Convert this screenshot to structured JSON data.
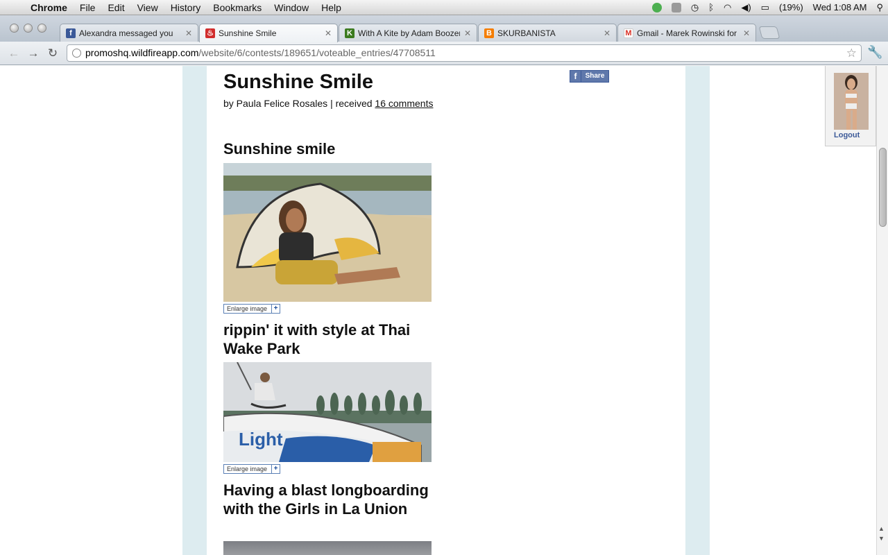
{
  "menubar": {
    "app_name": "Chrome",
    "items": [
      "File",
      "Edit",
      "View",
      "History",
      "Bookmarks",
      "Window",
      "Help"
    ],
    "battery": "(19%)",
    "clock": "Wed 1:08 AM"
  },
  "tabs": [
    {
      "title": "Alexandra messaged you",
      "icon": "facebook-icon",
      "color": "#3b5998",
      "glyph": "f"
    },
    {
      "title": "Sunshine Smile",
      "icon": "wildfire-icon",
      "color": "#d12d2d",
      "glyph": "♨"
    },
    {
      "title": "With A Kite by Adam Boozer",
      "icon": "kickstarter-icon",
      "color": "#3b7a1e",
      "glyph": "K"
    },
    {
      "title": "SKURBANISTA",
      "icon": "blogger-icon",
      "color": "#f57d00",
      "glyph": "B"
    },
    {
      "title": "Gmail - Marek Rowinski for S",
      "icon": "gmail-icon",
      "color": "#ffffff",
      "glyph": "M"
    }
  ],
  "address_bar": {
    "host": "promoshq.wildfireapp.com",
    "path": "/website/6/contests/189651/voteable_entries/47708511"
  },
  "entry": {
    "title": "Sunshine Smile",
    "by_prefix": "by Paula Felice Rosales | received ",
    "comments_link": "16 comments",
    "share_label": "Share"
  },
  "sections": [
    {
      "title": "Sunshine smile",
      "enlarge": "Enlarge image"
    },
    {
      "title": "rippin' it with style at Thai Wake Park",
      "enlarge": "Enlarge image"
    },
    {
      "title": "Having a blast longboarding with the Girls in La Union"
    }
  ],
  "user": {
    "logout": "Logout"
  }
}
